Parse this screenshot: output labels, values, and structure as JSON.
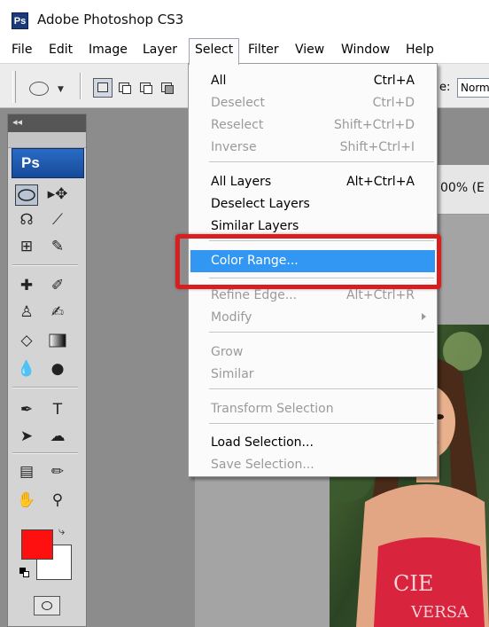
{
  "app": {
    "logo_text": "Ps",
    "title": "Adobe Photoshop CS3"
  },
  "menubar": {
    "items": [
      "File",
      "Edit",
      "Image",
      "Layer",
      "Select",
      "Filter",
      "View",
      "Window",
      "Help"
    ],
    "open_menu": "Select"
  },
  "options_bar": {
    "style_label": "e:",
    "style_value": "Norm"
  },
  "tools_panel": {
    "collapse_glyph": "◂◂",
    "badge": "Ps",
    "foreground_color": "#ff1010",
    "background_color": "#ffffff"
  },
  "document": {
    "title_fragment": "00% (E"
  },
  "select_menu": {
    "items": [
      {
        "label": "All",
        "shortcut": "Ctrl+A",
        "enabled": true
      },
      {
        "label": "Deselect",
        "shortcut": "Ctrl+D",
        "enabled": false
      },
      {
        "label": "Reselect",
        "shortcut": "Shift+Ctrl+D",
        "enabled": false
      },
      {
        "label": "Inverse",
        "shortcut": "Shift+Ctrl+I",
        "enabled": false
      },
      {
        "label": "All Layers",
        "shortcut": "Alt+Ctrl+A",
        "enabled": true
      },
      {
        "label": "Deselect Layers",
        "shortcut": "",
        "enabled": true
      },
      {
        "label": "Similar Layers",
        "shortcut": "",
        "enabled": true
      },
      {
        "label": "Color Range...",
        "shortcut": "",
        "enabled": true,
        "highlighted": true
      },
      {
        "label": "Refine Edge...",
        "shortcut": "Alt+Ctrl+R",
        "enabled": false
      },
      {
        "label": "Modify",
        "shortcut": "",
        "enabled": false,
        "submenu": true
      },
      {
        "label": "Grow",
        "shortcut": "",
        "enabled": false
      },
      {
        "label": "Similar",
        "shortcut": "",
        "enabled": false
      },
      {
        "label": "Transform Selection",
        "shortcut": "",
        "enabled": false
      },
      {
        "label": "Load Selection...",
        "shortcut": "",
        "enabled": true
      },
      {
        "label": "Save Selection...",
        "shortcut": "",
        "enabled": false
      }
    ]
  },
  "colors": {
    "highlight": "#3297f3",
    "annotation_box": "#d62020",
    "ps_blue": "#174a9a"
  }
}
